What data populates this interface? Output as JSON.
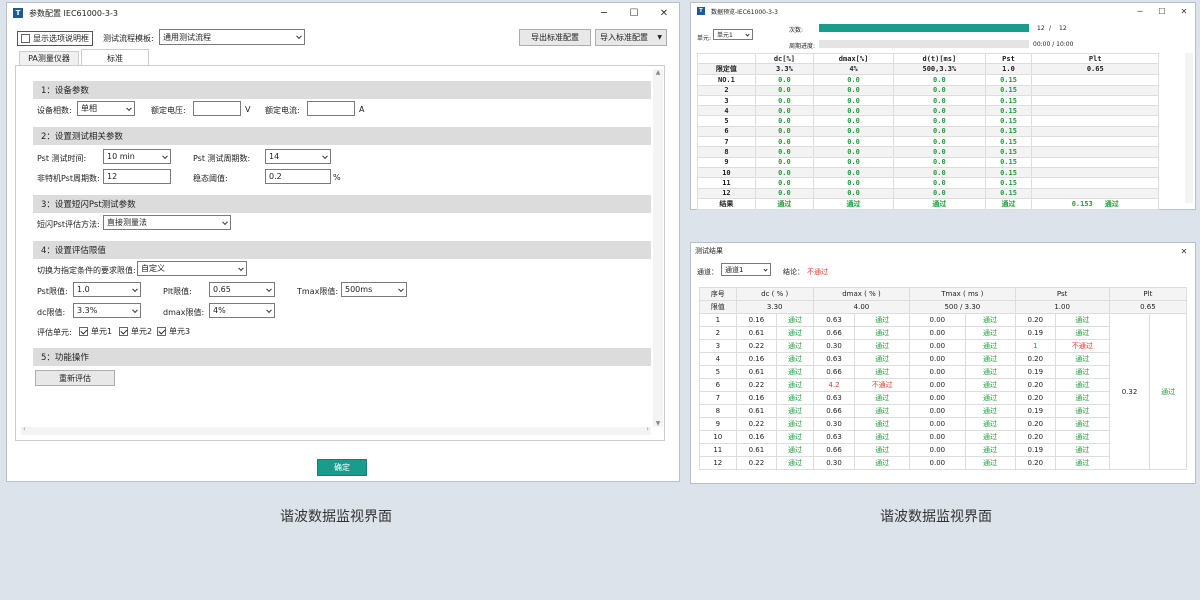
{
  "win1": {
    "title": "参数配置 IEC61000-3-3",
    "show_desc_label": "显示选项说明框",
    "template_label": "测试流程模板:",
    "template_value": "通用测试流程",
    "export_btn": "导出标准配置",
    "import_btn": "导入标准配置",
    "tabs": [
      "PA测量仪器",
      "标准"
    ],
    "sec1": "1：设备参数",
    "phase_label": "设备相数:",
    "phase_value": "单相",
    "rated_v_label": "额定电压:",
    "rated_v_unit": "V",
    "rated_i_label": "额定电流:",
    "rated_i_unit": "A",
    "sec2": "2：设置测试相关参数",
    "pst_time_label": "Pst 测试时间:",
    "pst_time_value": "10 min",
    "pst_cycles_label": "Pst 测试周期数:",
    "pst_cycles_value": "14",
    "nonperiod_label": "非特机Pst周期数:",
    "nonperiod_value": "12",
    "steady_label": "稳态阈值:",
    "steady_value": "0.2",
    "steady_unit": "%",
    "sec3": "3：设置短闪Pst测试参数",
    "method_label": "短闪Pst评估方法:",
    "method_value": "直接测量法",
    "sec4": "4：设置评估限值",
    "switch_label": "切换为指定条件的要求限值:",
    "switch_value": "自定义",
    "pst_limit_label": "Pst限值:",
    "pst_limit_value": "1.0",
    "plt_limit_label": "Plt限值:",
    "plt_limit_value": "0.65",
    "tmax_limit_label": "Tmax限值:",
    "tmax_limit_value": "500ms",
    "dc_limit_label": "dc限值:",
    "dc_limit_value": "3.3%",
    "dmax_limit_label": "dmax限值:",
    "dmax_limit_value": "4%",
    "eval_units_label": "评估单元:",
    "units": [
      "单元1",
      "单元2",
      "单元3"
    ],
    "sec5": "5：功能操作",
    "reeval_btn": "重新评估",
    "ok_btn": "确定",
    "accent": "#1a9c8c"
  },
  "win2": {
    "title": "数据预览-IEC61000-3-3",
    "count_label": "次数:",
    "count_done": "12",
    "count_sep": "/",
    "count_total": "12",
    "cycle_label": "周期进度:",
    "cycle_value": "00:00 / 10:00",
    "unit_label": "单元:",
    "unit_value": "单元1",
    "count_progress": 1.0,
    "headers": [
      "",
      "dc[%]",
      "dmax[%]",
      "d(t)[ms]",
      "Pst",
      "Plt"
    ],
    "limit_row": [
      "限定值",
      "3.3%",
      "4%",
      "500,3.3%",
      "1.0",
      "0.65"
    ],
    "rows": [
      [
        "NO.1",
        "0.0",
        "0.0",
        "0.0",
        "0.15",
        ""
      ],
      [
        "2",
        "0.0",
        "0.0",
        "0.0",
        "0.15",
        ""
      ],
      [
        "3",
        "0.0",
        "0.0",
        "0.0",
        "0.15",
        ""
      ],
      [
        "4",
        "0.0",
        "0.0",
        "0.0",
        "0.15",
        ""
      ],
      [
        "5",
        "0.0",
        "0.0",
        "0.0",
        "0.15",
        ""
      ],
      [
        "6",
        "0.0",
        "0.0",
        "0.0",
        "0.15",
        ""
      ],
      [
        "7",
        "0.0",
        "0.0",
        "0.0",
        "0.15",
        ""
      ],
      [
        "8",
        "0.0",
        "0.0",
        "0.0",
        "0.15",
        ""
      ],
      [
        "9",
        "0.0",
        "0.0",
        "0.0",
        "0.15",
        ""
      ],
      [
        "10",
        "0.0",
        "0.0",
        "0.0",
        "0.15",
        ""
      ],
      [
        "11",
        "0.0",
        "0.0",
        "0.0",
        "0.15",
        ""
      ],
      [
        "12",
        "0.0",
        "0.0",
        "0.0",
        "0.15",
        ""
      ]
    ],
    "result_row": [
      "结果",
      "通过",
      "通过",
      "通过",
      "通过",
      "0.153",
      "通过"
    ]
  },
  "win3": {
    "title": "测试结果",
    "channel_label": "通道：",
    "channel_value": "通道1",
    "conclusion_label": "结论：",
    "conclusion_value": "不通过",
    "headers": [
      "序号",
      "dc ( % )",
      "dmax ( % )",
      "Tmax ( ms )",
      "Pst",
      "Plt"
    ],
    "limit_row": [
      "限值",
      "3.30",
      "4.00",
      "500 / 3.30",
      "1.00",
      "0.65"
    ],
    "rows": [
      [
        "1",
        "0.16",
        "通过",
        "0.63",
        "通过",
        "0.00",
        "通过",
        "0.20",
        "通过"
      ],
      [
        "2",
        "0.61",
        "通过",
        "0.66",
        "通过",
        "0.00",
        "通过",
        "0.19",
        "通过"
      ],
      [
        "3",
        "0.22",
        "通过",
        "0.30",
        "通过",
        "0.00",
        "通过",
        "1",
        "不通过"
      ],
      [
        "4",
        "0.16",
        "通过",
        "0.63",
        "通过",
        "0.00",
        "通过",
        "0.20",
        "通过"
      ],
      [
        "5",
        "0.61",
        "通过",
        "0.66",
        "通过",
        "0.00",
        "通过",
        "0.19",
        "通过"
      ],
      [
        "6",
        "0.22",
        "通过",
        "4.2",
        "不通过",
        "0.00",
        "通过",
        "0.20",
        "通过"
      ],
      [
        "7",
        "0.16",
        "通过",
        "0.63",
        "通过",
        "0.00",
        "通过",
        "0.20",
        "通过"
      ],
      [
        "8",
        "0.61",
        "通过",
        "0.66",
        "通过",
        "0.00",
        "通过",
        "0.19",
        "通过"
      ],
      [
        "9",
        "0.22",
        "通过",
        "0.30",
        "通过",
        "0.00",
        "通过",
        "0.20",
        "通过"
      ],
      [
        "10",
        "0.16",
        "通过",
        "0.63",
        "通过",
        "0.00",
        "通过",
        "0.20",
        "通过"
      ],
      [
        "11",
        "0.61",
        "通过",
        "0.66",
        "通过",
        "0.00",
        "通过",
        "0.19",
        "通过"
      ],
      [
        "12",
        "0.22",
        "通过",
        "0.30",
        "通过",
        "0.00",
        "通过",
        "0.20",
        "通过"
      ]
    ],
    "plt_value": "0.32",
    "plt_result": "通过"
  },
  "captions": [
    "谐波数据监视界面",
    "谐波数据监视界面"
  ],
  "colors": {
    "pass": "#1e9e3b",
    "fail": "#e03a2a"
  }
}
